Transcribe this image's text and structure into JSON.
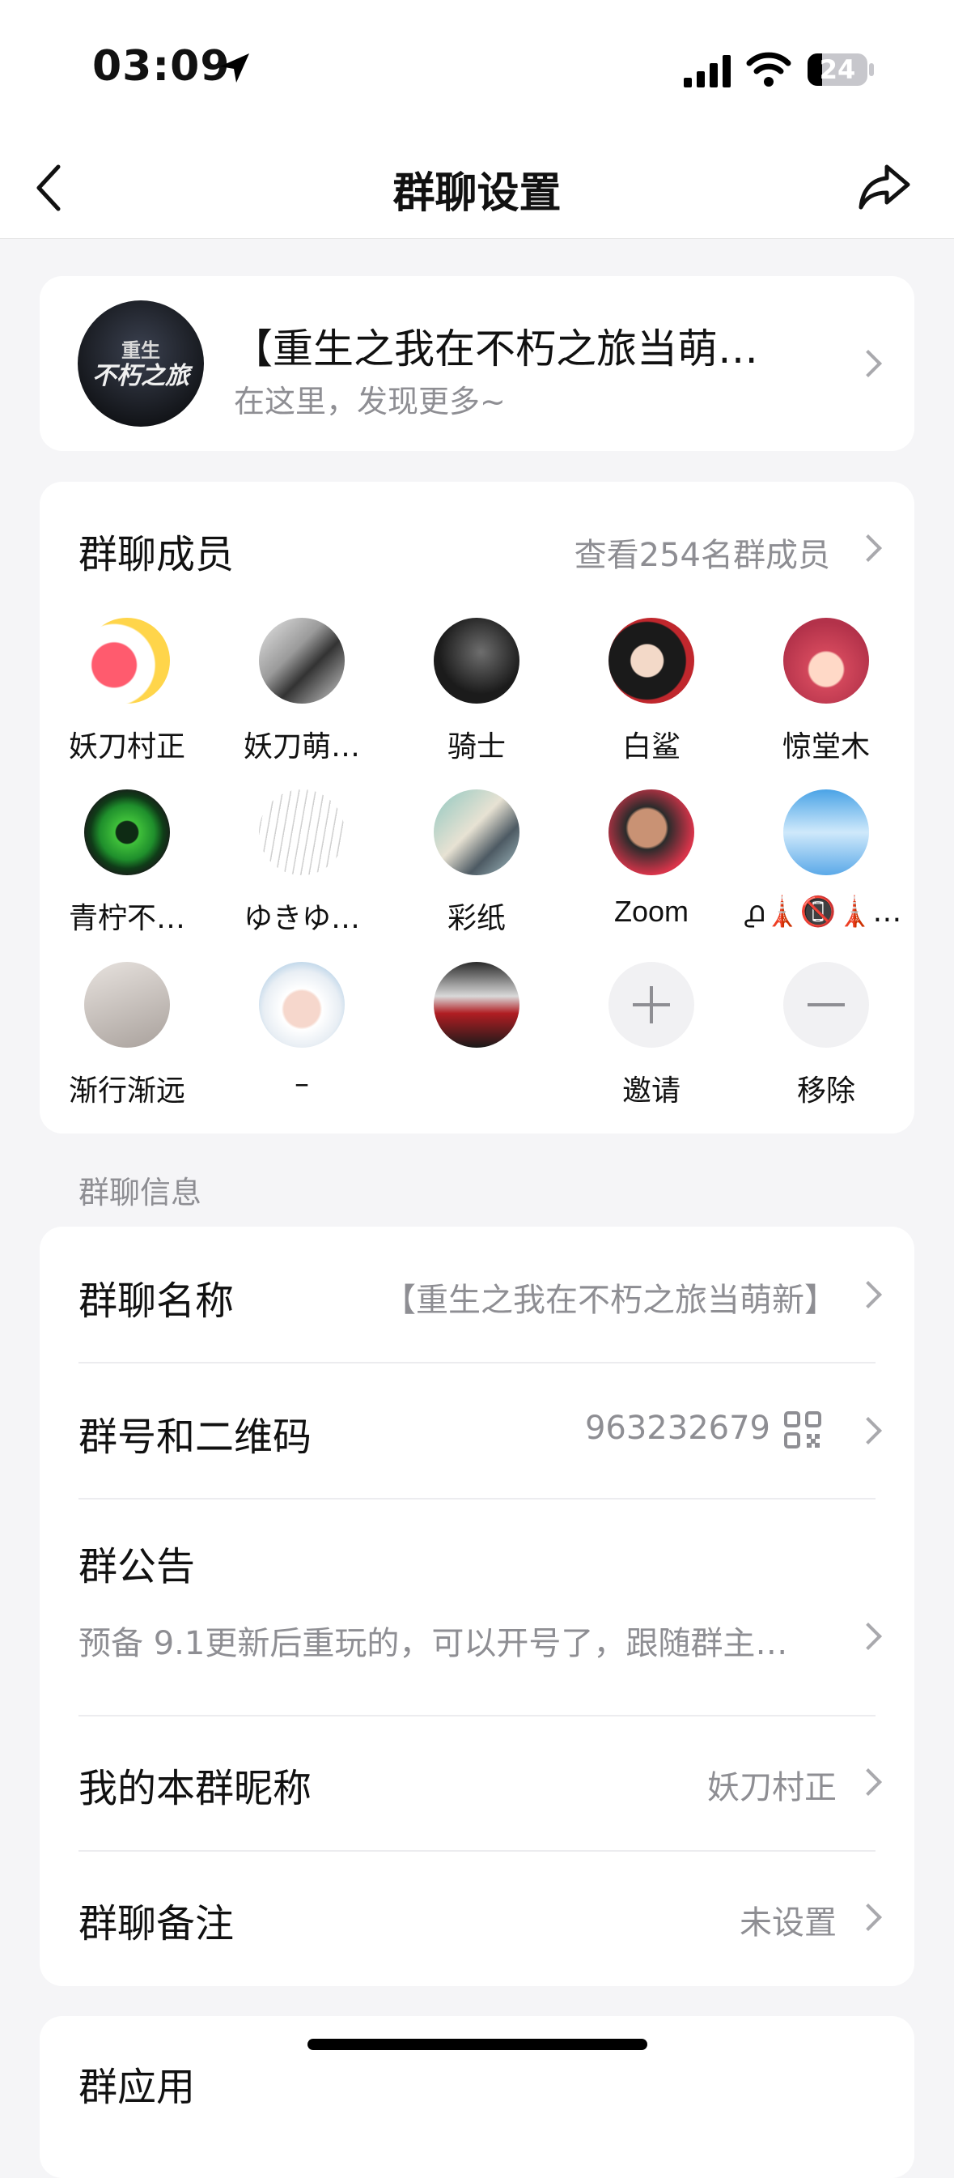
{
  "status": {
    "time": "03:09",
    "battery": "24"
  },
  "nav": {
    "title": "群聊设置"
  },
  "group_header": {
    "name": "【重生之我在不朽之旅当萌…",
    "subtitle": "在这里，发现更多~",
    "logo_top": "重生",
    "logo_bottom": "不朽之旅"
  },
  "members": {
    "title": "群聊成员",
    "view_all": "查看254名群成员",
    "list": [
      {
        "name": "妖刀村正"
      },
      {
        "name": "妖刀萌…"
      },
      {
        "name": "骑士"
      },
      {
        "name": "白鲨"
      },
      {
        "name": "惊堂木"
      },
      {
        "name": "青柠不…"
      },
      {
        "name": "ゆきゆ…"
      },
      {
        "name": "彩纸"
      },
      {
        "name": "Zoom"
      },
      {
        "name": "൧🗼📵🗼൧…"
      },
      {
        "name": "渐行渐远"
      },
      {
        "name": "–"
      },
      {
        "name": ""
      }
    ],
    "invite": "邀请",
    "remove": "移除"
  },
  "info_section_label": "群聊信息",
  "info": {
    "group_name_label": "群聊名称",
    "group_name_value": "【重生之我在不朽之旅当萌新】",
    "group_id_label": "群号和二维码",
    "group_id_value": "963232679",
    "notice_label": "群公告",
    "notice_value": "预备 9.1更新后重玩的，可以开号了，跟随群主…",
    "nickname_label": "我的本群昵称",
    "nickname_value": "妖刀村正",
    "remark_label": "群聊备注",
    "remark_value": "未设置"
  },
  "next_card_label": "群应用"
}
